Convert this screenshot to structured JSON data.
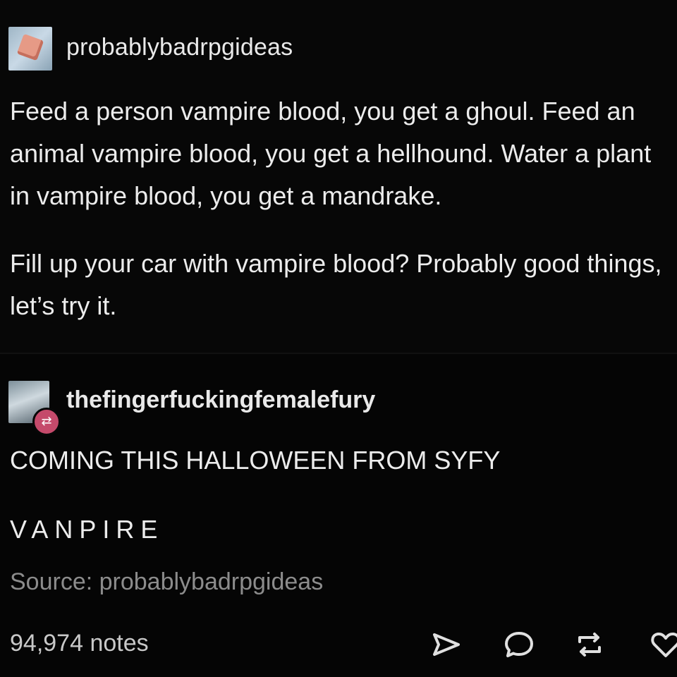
{
  "post": {
    "original": {
      "username": "probablybadrpgideas",
      "avatar_icon": "d20-dice-avatar",
      "paragraphs": [
        "Feed a person vampire blood, you get a ghoul. Feed an animal vampire blood, you get a hellhound. Water a plant in vampire blood, you get a mandrake.",
        "Fill up your car with vampire blood? Probably good things, let’s try it."
      ]
    },
    "reblog": {
      "username": "thefingerfuckingfemalefury",
      "avatar_icon": "user-avatar",
      "badge_icon": "reblog-icon",
      "lines": [
        "COMING THIS HALLOWEEN FROM SYFY",
        "VANPIRE"
      ]
    },
    "source": "Source: probablybadrpgideas",
    "notes": "94,974 notes",
    "actions": [
      "share-icon",
      "reply-icon",
      "reblog-icon",
      "heart-icon"
    ]
  },
  "colors": {
    "background": "#000000",
    "text": "#ececec",
    "muted": "#8c8c8c",
    "badge": "#c54a6b"
  }
}
